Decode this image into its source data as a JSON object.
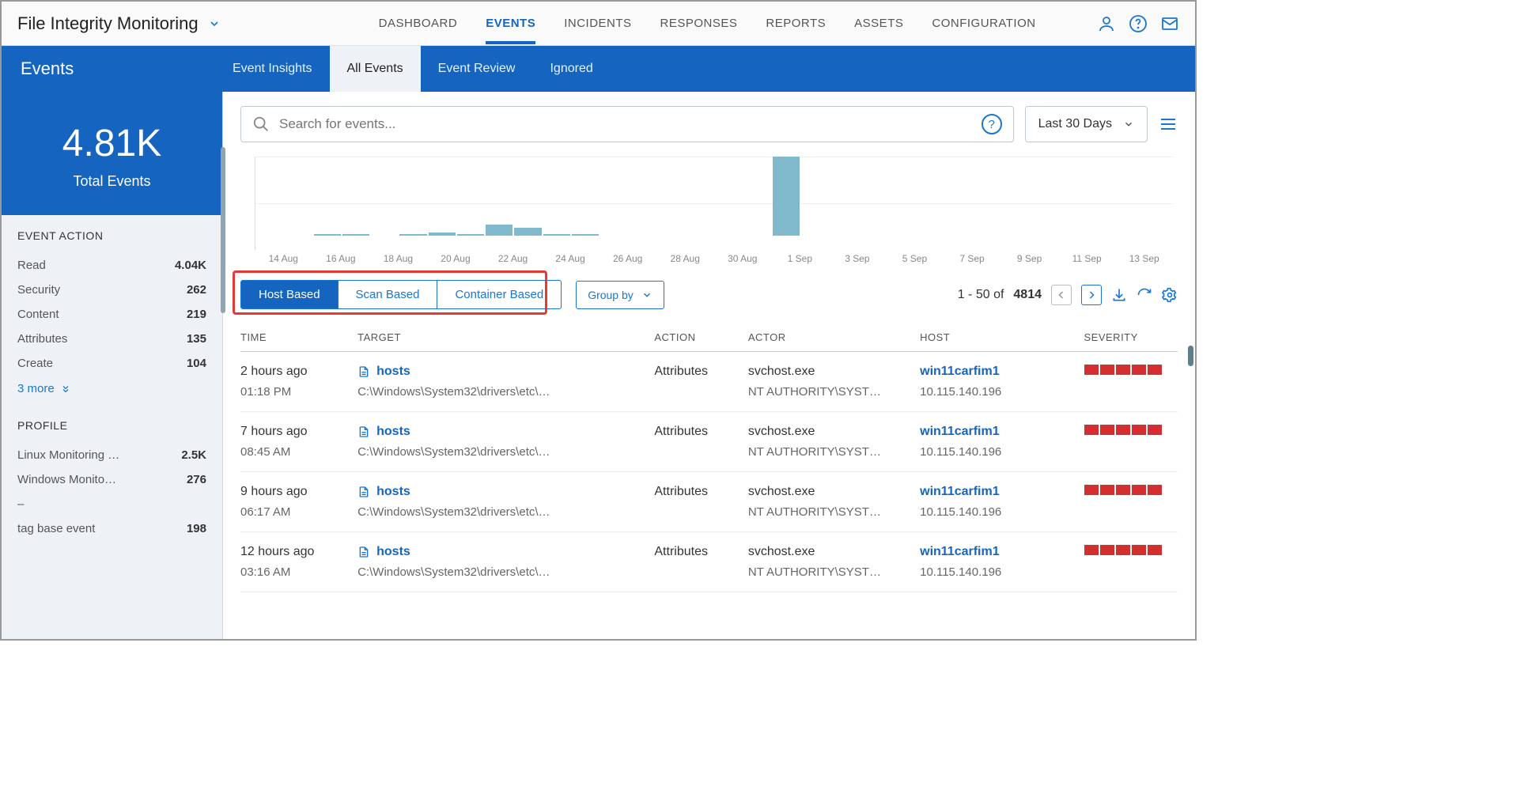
{
  "app": {
    "title": "File Integrity Monitoring"
  },
  "topnav": {
    "items": [
      "DASHBOARD",
      "EVENTS",
      "INCIDENTS",
      "RESPONSES",
      "REPORTS",
      "ASSETS",
      "CONFIGURATION"
    ],
    "active": "EVENTS"
  },
  "subheader": {
    "title": "Events",
    "tabs": [
      "Event Insights",
      "All Events",
      "Event Review",
      "Ignored"
    ],
    "active": "All Events"
  },
  "stat": {
    "value": "4.81K",
    "label": "Total Events"
  },
  "facets": {
    "event_action": {
      "title": "EVENT ACTION",
      "rows": [
        {
          "label": "Read",
          "count": "4.04K"
        },
        {
          "label": "Security",
          "count": "262"
        },
        {
          "label": "Content",
          "count": "219"
        },
        {
          "label": "Attributes",
          "count": "135"
        },
        {
          "label": "Create",
          "count": "104"
        }
      ],
      "more": "3 more"
    },
    "profile": {
      "title": "PROFILE",
      "rows": [
        {
          "label": "Linux Monitoring …",
          "count": "2.5K"
        },
        {
          "label": "Windows Monito…",
          "count": "276"
        },
        {
          "label": "–",
          "count": ""
        },
        {
          "label": "tag base event",
          "count": "198"
        }
      ]
    }
  },
  "search": {
    "placeholder": "Search for events..."
  },
  "daterange": {
    "label": "Last 30 Days"
  },
  "chart_data": {
    "type": "bar",
    "categories": [
      "14 Aug",
      "16 Aug",
      "18 Aug",
      "20 Aug",
      "22 Aug",
      "24 Aug",
      "26 Aug",
      "28 Aug",
      "30 Aug",
      "1 Sep",
      "3 Sep",
      "5 Sep",
      "7 Sep",
      "9 Sep",
      "11 Sep",
      "13 Sep"
    ],
    "values": [
      0,
      0,
      2,
      2,
      0,
      2,
      4,
      2,
      14,
      10,
      2,
      2,
      0,
      0,
      0,
      0,
      0,
      0,
      100,
      0,
      0,
      0,
      0,
      0,
      0,
      0,
      0,
      0,
      0,
      0,
      0,
      0
    ],
    "xlabel": "",
    "ylabel": "",
    "title": "",
    "ylim": [
      0,
      100
    ]
  },
  "segments": {
    "items": [
      "Host Based",
      "Scan Based",
      "Container Based"
    ],
    "active": "Host Based"
  },
  "groupby": {
    "label": "Group by"
  },
  "pager": {
    "range": "1 - 50 of",
    "total": "4814"
  },
  "columns": [
    "TIME",
    "TARGET",
    "ACTION",
    "ACTOR",
    "HOST",
    "SEVERITY"
  ],
  "rows": [
    {
      "time_rel": "2 hours ago",
      "time_abs": "01:18 PM",
      "target_name": "hosts",
      "target_path": "C:\\Windows\\System32\\drivers\\etc\\…",
      "action": "Attributes",
      "actor_proc": "svchost.exe",
      "actor_user": "NT AUTHORITY\\SYST…",
      "host_name": "win11carfim1",
      "host_ip": "10.115.140.196",
      "severity": 5
    },
    {
      "time_rel": "7 hours ago",
      "time_abs": "08:45 AM",
      "target_name": "hosts",
      "target_path": "C:\\Windows\\System32\\drivers\\etc\\…",
      "action": "Attributes",
      "actor_proc": "svchost.exe",
      "actor_user": "NT AUTHORITY\\SYST…",
      "host_name": "win11carfim1",
      "host_ip": "10.115.140.196",
      "severity": 5
    },
    {
      "time_rel": "9 hours ago",
      "time_abs": "06:17 AM",
      "target_name": "hosts",
      "target_path": "C:\\Windows\\System32\\drivers\\etc\\…",
      "action": "Attributes",
      "actor_proc": "svchost.exe",
      "actor_user": "NT AUTHORITY\\SYST…",
      "host_name": "win11carfim1",
      "host_ip": "10.115.140.196",
      "severity": 5
    },
    {
      "time_rel": "12 hours ago",
      "time_abs": "03:16 AM",
      "target_name": "hosts",
      "target_path": "C:\\Windows\\System32\\drivers\\etc\\…",
      "action": "Attributes",
      "actor_proc": "svchost.exe",
      "actor_user": "NT AUTHORITY\\SYST…",
      "host_name": "win11carfim1",
      "host_ip": "10.115.140.196",
      "severity": 5
    }
  ]
}
